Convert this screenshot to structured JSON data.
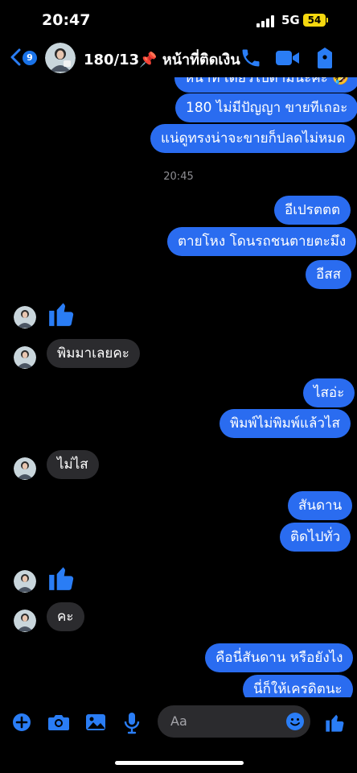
{
  "status_bar": {
    "time": "20:47",
    "network": "5G",
    "battery": "54"
  },
  "header": {
    "back_badge": "9",
    "title": "180/13📌 หน้าที่ติดเงิน",
    "accent": "#1a73e8"
  },
  "messages": {
    "m0": "หน้าที่ เดี๋ยวไปตามนะคะ 🤣",
    "m1": "180 ไม่มีปัญญา ขายทีเถอะ",
    "m2": "แน่ดูทรงน่าจะขายก็ปลดไม่หมด",
    "timestamp": "20:45",
    "m3": "อีเปรตตต",
    "m4": "ตายโหง โดนรถชนตายตะมึง",
    "m5": "อีสส",
    "m6": "พิมมาเลยคะ",
    "m7": "ไสอ่ะ",
    "m8": "พิมพ์ไม่พิมพ์แล้วไส",
    "m9": "ไม่ไส",
    "m10": "สันดาน",
    "m11": "ติดไปทั่ว",
    "m12": "คะ",
    "m13": "คือนี่สันดาน หรือยังไง",
    "m14": "นี่ก็ให้เครดิตนะ"
  },
  "composer": {
    "placeholder": "Aa"
  }
}
